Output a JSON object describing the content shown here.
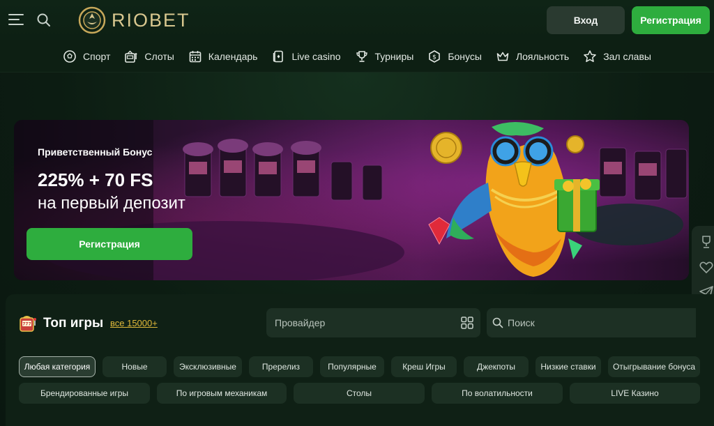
{
  "header": {
    "logo_text": "RIOBET",
    "login_label": "Вход",
    "register_label": "Регистрация"
  },
  "nav": {
    "items": [
      {
        "label": "Спорт",
        "icon": "soccer-ball-icon"
      },
      {
        "label": "Слоты",
        "icon": "slot-machine-icon"
      },
      {
        "label": "Календарь",
        "icon": "calendar-icon"
      },
      {
        "label": "Live casino",
        "icon": "cards-icon"
      },
      {
        "label": "Турниры",
        "icon": "trophy-icon"
      },
      {
        "label": "Бонусы",
        "icon": "dollar-coin-icon"
      },
      {
        "label": "Лояльность",
        "icon": "crown-icon"
      },
      {
        "label": "Зал славы",
        "icon": "star-icon"
      }
    ]
  },
  "banner": {
    "subtitle": "Приветственный Бонус",
    "amount": "225% + 70 FS",
    "description": "на первый депозит",
    "button_label": "Регистрация"
  },
  "games": {
    "title": "Топ игры",
    "count_link": "все 15000+",
    "provider_placeholder": "Провайдер",
    "search_placeholder": "Поиск",
    "categories_row1": [
      "Любая категория",
      "Новые",
      "Эксклюзивные",
      "Пререлиз",
      "Популярные",
      "Креш Игры",
      "Джекпоты",
      "Низкие ставки",
      "Отыгрывание бонуса"
    ],
    "categories_row2": [
      "Брендированные игры",
      "По игровым механикам",
      "Столы",
      "По волатильности",
      "LIVE Казино"
    ]
  },
  "colors": {
    "accent_green": "#2ead3e",
    "gold": "#d8c78f",
    "link_gold": "#e0b93a",
    "background": "#0b1a11"
  },
  "side_rail": {
    "icons": [
      "trophy-icon",
      "heart-icon",
      "telegram-icon",
      "chat-icon",
      "message-icon"
    ]
  }
}
